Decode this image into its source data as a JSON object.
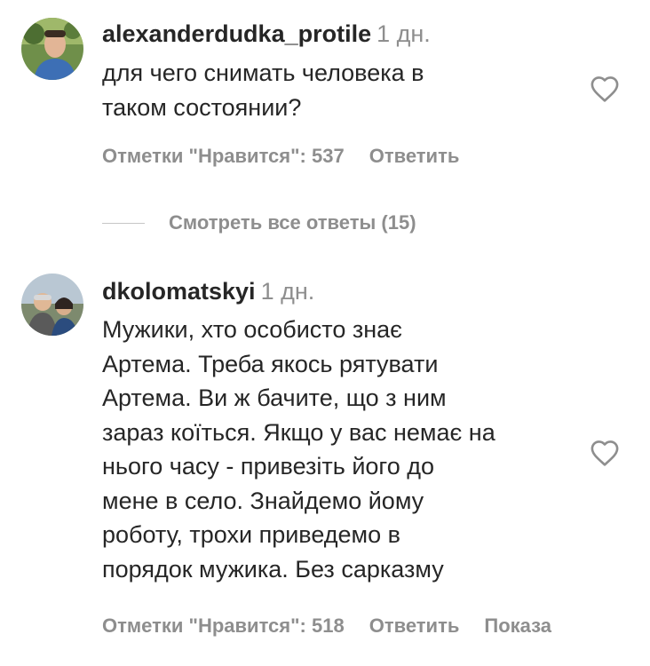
{
  "comments": [
    {
      "username": "alexanderdudka_protile",
      "timestamp": "1 дн.",
      "text": "для чего снимать человека в\nтаком состоянии?",
      "likes_label": "Отметки \"Нравится\": 537",
      "reply_label": "Ответить",
      "view_replies_label": "Смотреть все ответы (15)"
    },
    {
      "username": "dkolomatskyi",
      "timestamp": "1 дн.",
      "text": "Мужики, хто особисто знає\nАртема. Треба якось рятувати\nАртема. Ви ж бачите, що з ним\nзараз коїться. Якщо у вас немає на\nнього часу - привезіть його до\nмене в село. Знайдемо йому\nроботу, трохи приведемо в\nпорядок мужика. Без сарказму",
      "likes_label": "Отметки \"Нравится\": 518",
      "reply_label": "Ответить",
      "show_more_label": "Показа"
    }
  ],
  "icons": {
    "like": "heart-outline-icon"
  },
  "colors": {
    "primary_text": "#262626",
    "secondary_text": "#8e8e8e",
    "divider": "#c7c7c7"
  }
}
